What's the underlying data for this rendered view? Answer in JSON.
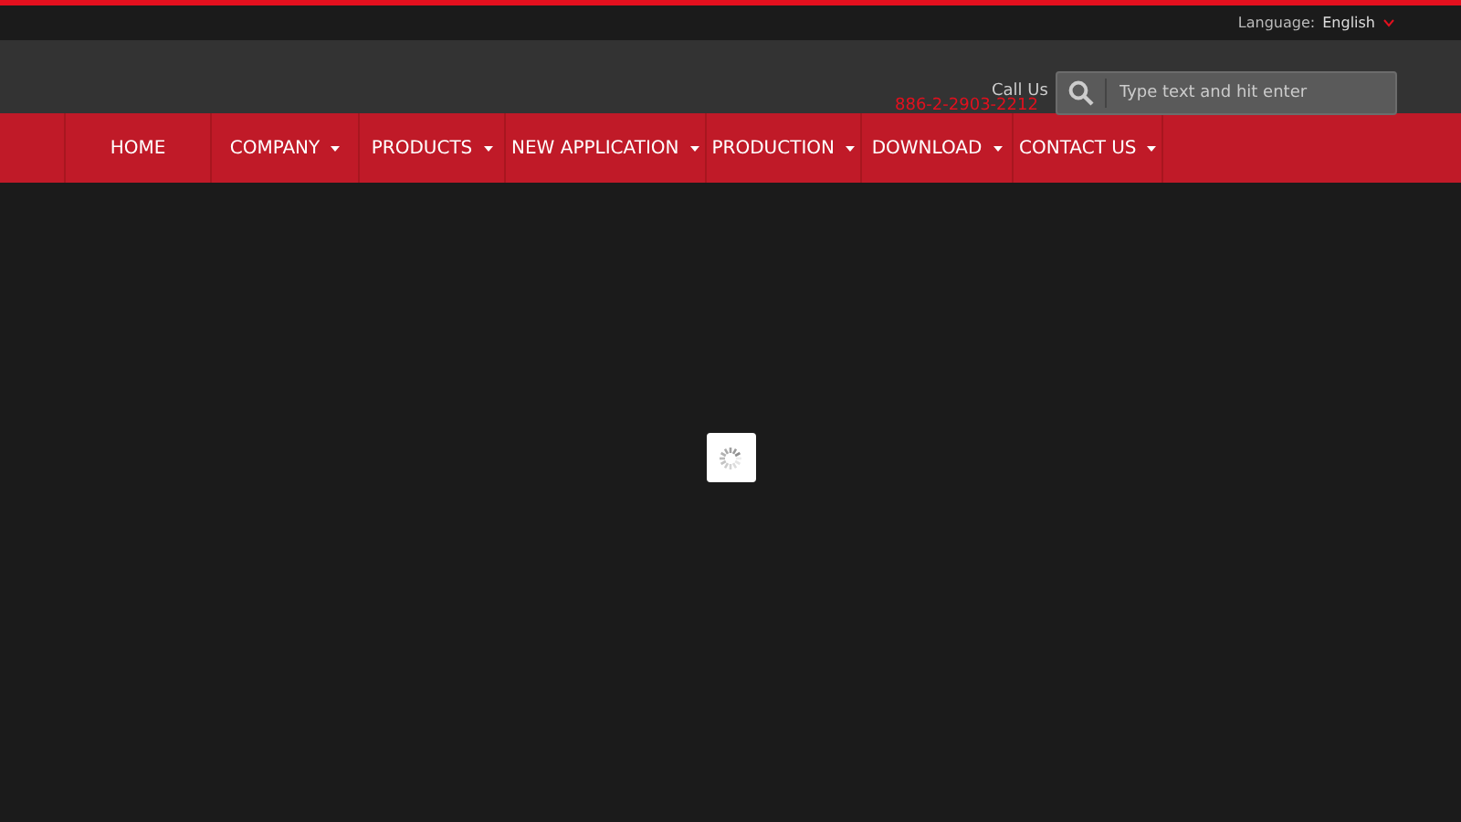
{
  "top_bar": {
    "language_label": "Language:",
    "language_value": "English"
  },
  "header": {
    "call_label": "Call Us",
    "phone": "886-2-2903-2212",
    "search": {
      "placeholder": "Type text and hit enter"
    }
  },
  "nav": [
    {
      "label": "HOME",
      "has_menu": false
    },
    {
      "label": "COMPANY",
      "has_menu": true
    },
    {
      "label": "PRODUCTS",
      "has_menu": true
    },
    {
      "label": "NEW APPLICATION",
      "has_menu": true
    },
    {
      "label": "PRODUCTION",
      "has_menu": true
    },
    {
      "label": "DOWNLOAD",
      "has_menu": true
    },
    {
      "label": "CONTACT US",
      "has_menu": true
    }
  ],
  "content": {
    "loading": true
  }
}
